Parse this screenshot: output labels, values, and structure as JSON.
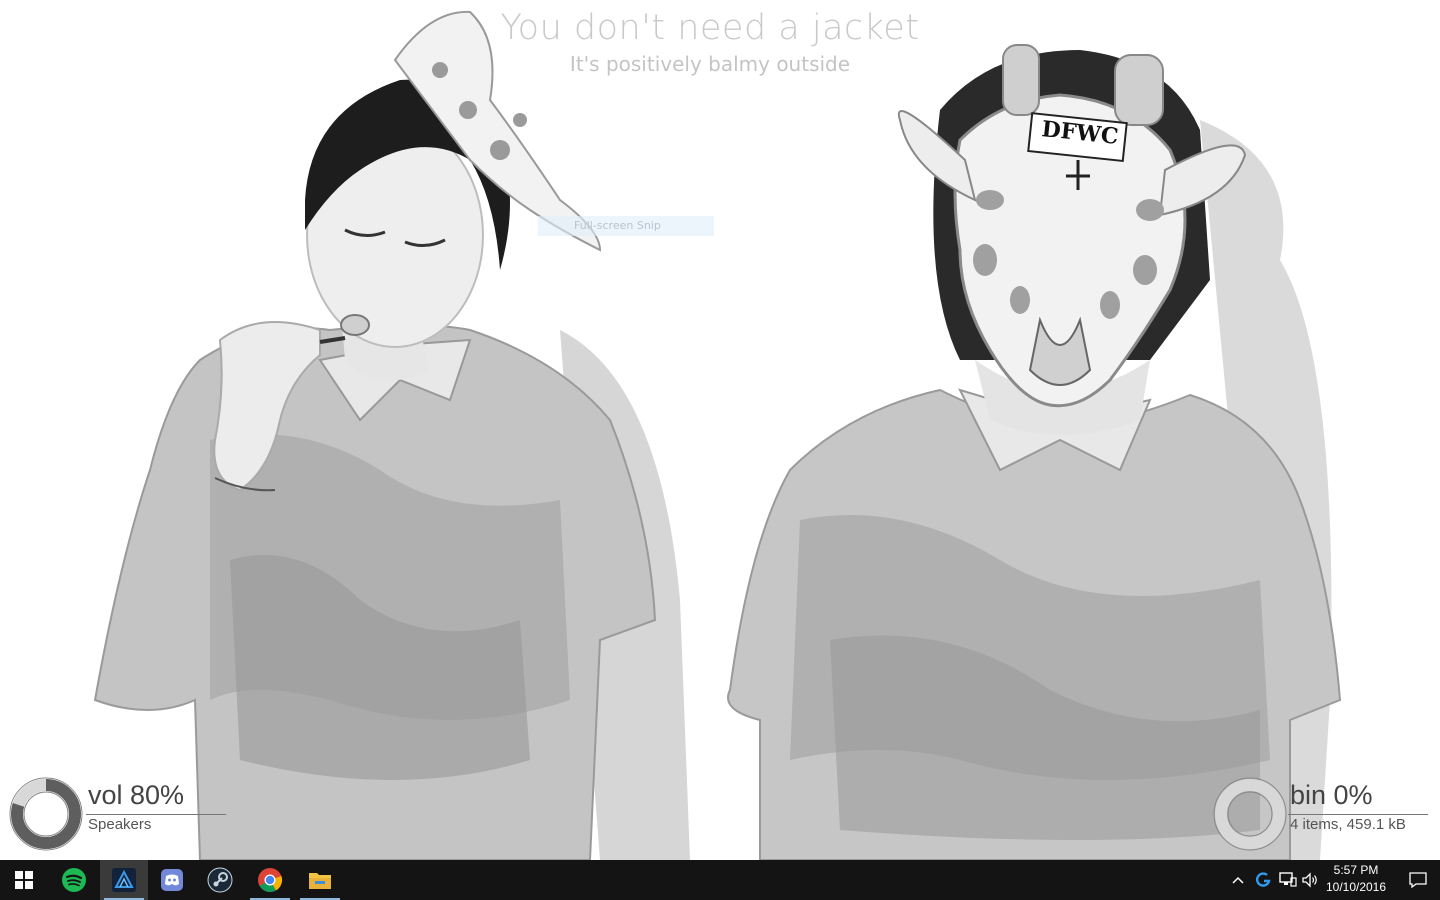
{
  "weather": {
    "headline": "You don't need a jacket",
    "subline": "It's positively balmy outside"
  },
  "snip": {
    "label": "Full-screen Snip"
  },
  "wallpaper": {
    "mask_text": "DFWC"
  },
  "volume_gauge": {
    "title": "vol 80%",
    "device": "Speakers",
    "level": 0.8
  },
  "bin_gauge": {
    "title": "bin 0%",
    "details": "4 items, 459.1 kB",
    "level": 0.0
  },
  "taskbar": {
    "apps": [
      {
        "icon": "windows-start-icon"
      },
      {
        "icon": "spotify-icon",
        "color": "#1db954"
      },
      {
        "icon": "rainmeter-icon",
        "color": "#2a7fd4"
      },
      {
        "icon": "discord-icon",
        "color": "#7289da"
      },
      {
        "icon": "steam-icon",
        "color": "#1b2838"
      },
      {
        "icon": "chrome-icon"
      },
      {
        "icon": "file-explorer-icon",
        "color": "#f3c542"
      }
    ],
    "clock": {
      "time": "5:57 PM",
      "date": "10/10/2016"
    }
  },
  "colors": {
    "taskbar_bg": "#141414",
    "accent": "#8fb8de"
  }
}
